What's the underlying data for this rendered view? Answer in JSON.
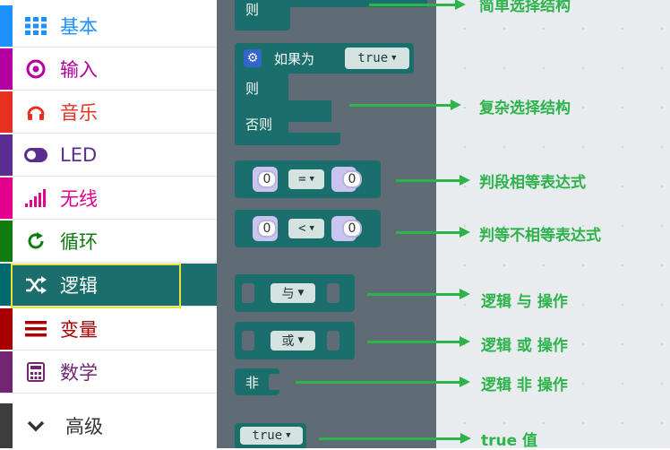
{
  "sidebar": {
    "items": [
      {
        "label": "基本",
        "color": "#1e90ff",
        "icon": "grid-icon"
      },
      {
        "label": "输入",
        "color": "#b4009e",
        "icon": "target-icon"
      },
      {
        "label": "音乐",
        "color": "#e63022",
        "icon": "headphones-icon"
      },
      {
        "label": "LED",
        "color": "#5c2d91",
        "icon": "toggle-icon"
      },
      {
        "label": "无线",
        "color": "#e3008c",
        "icon": "signal-bars-icon"
      },
      {
        "label": "循环",
        "color": "#107c10",
        "icon": "loop-icon"
      },
      {
        "label": "逻辑",
        "color": "#006970",
        "icon": "shuffle-icon"
      },
      {
        "label": "变量",
        "color": "#a80000",
        "icon": "list-lines-icon"
      },
      {
        "label": "数学",
        "color": "#712672",
        "icon": "calculator-icon"
      },
      {
        "label": "高级",
        "color": "#3c3c3c",
        "icon": "chevron-down-icon"
      }
    ]
  },
  "blocks": {
    "then_top": "则",
    "if_label": "如果为",
    "if_value": "true",
    "then_label": "则",
    "else_label": "否则",
    "compare_eq": {
      "left": "0",
      "op": "=",
      "right": "0"
    },
    "compare_lt": {
      "left": "0",
      "op": "<",
      "right": "0"
    },
    "and_op": "与",
    "or_op": "或",
    "not_label": "非",
    "true_value": "true"
  },
  "annotations": {
    "simple": "简单选择结构",
    "complex": "复杂选择结构",
    "eq": "判段相等表达式",
    "neq": "判等不相等表达式",
    "and": "逻辑 与 操作",
    "or": "逻辑 或 操作",
    "not": "逻辑 非 操作",
    "true": "true 值"
  },
  "colors": {
    "logic": "#1a6e6b",
    "annotation": "#2cb34a",
    "flyout": "#5f6b75"
  }
}
